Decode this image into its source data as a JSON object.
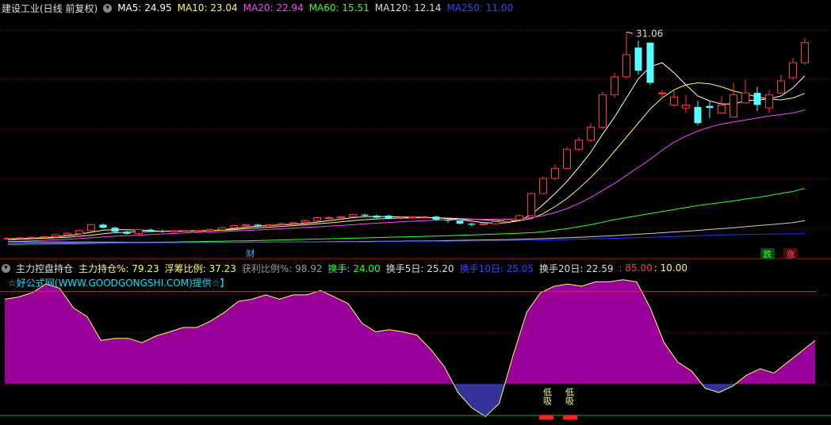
{
  "colors": {
    "up": "#ff3b3b",
    "down": "#55ffff",
    "ma5": "#ffffff",
    "ma10": "#ffff4d",
    "ma20": "#ff44ff",
    "ma60": "#33ff33",
    "ma120": "#cccccc",
    "ma250": "#2233ff",
    "fill_pos": "#990099",
    "fill_neg": "#333399",
    "grid": "#aa0000"
  },
  "header": {
    "stock_title": "建设工业(日线 前复权)",
    "toggle_icon": "chevron-down-icon",
    "ma5_label": "MA5: 24.95",
    "ma10_label": "MA10: 23.04",
    "ma20_label": "MA20: 22.94",
    "ma60_label": "MA60: 15.51",
    "ma120_label": "MA120: 12.14",
    "ma250_label": "MA250: 11.00"
  },
  "indicator": {
    "name": "主力控盘持仓",
    "zlcc": "主力持仓%: 79.23",
    "fcbl": "浮筹比例: 37.23",
    "hlbl": "获利比例%: 98.92",
    "hs": "换手: 24.00",
    "hs5": "换手5日: 25.20",
    "hs10": "换手10日: 25.05",
    "hs20": "换手20日: 22.59",
    "level_high": ": 85.00",
    "level_low": ": 10.00",
    "credit": "☆好公式网(WWW.GOODGONGSHI.COM)提供☆】",
    "low_marker": "低吸"
  },
  "markers": {
    "cai": "财",
    "die": "跌",
    "zhang": "涨",
    "high_price": "31.06"
  },
  "chart_data": [
    {
      "type": "candlestick",
      "title": "建设工业(日线 前复权)",
      "high_label": "31.06",
      "ylim": [
        9.8,
        32.5
      ],
      "x": [
        0,
        1,
        2,
        3,
        4,
        5,
        6,
        7,
        8,
        9,
        10,
        11,
        12,
        13,
        14,
        15,
        16,
        17,
        18,
        19,
        20,
        21,
        22,
        23,
        24,
        25,
        26,
        27,
        28,
        29,
        30,
        31,
        32,
        33,
        34,
        35,
        36,
        37,
        38,
        39,
        40,
        41,
        42,
        43,
        44,
        45,
        46,
        47,
        48,
        49,
        50,
        51,
        52,
        53,
        54,
        55,
        56,
        57,
        58,
        59,
        60,
        61,
        62,
        63,
        64,
        65,
        66,
        67
      ],
      "open": [
        10.5,
        10.55,
        10.6,
        10.65,
        10.7,
        10.9,
        11.0,
        11.3,
        11.9,
        11.6,
        11.2,
        11.0,
        11.4,
        11.3,
        11.2,
        11.25,
        11.3,
        11.3,
        11.4,
        11.6,
        11.8,
        11.9,
        11.8,
        11.9,
        12.0,
        12.1,
        12.3,
        12.6,
        12.6,
        12.7,
        12.9,
        12.8,
        12.8,
        12.55,
        12.6,
        12.7,
        12.7,
        12.4,
        12.3,
        12.0,
        11.9,
        12.0,
        12.2,
        12.4,
        12.8,
        15.0,
        16.5,
        17.5,
        19.4,
        20.3,
        21.6,
        24.8,
        26.6,
        29.5,
        30.0,
        25.0,
        23.8,
        23.5,
        23.6,
        23.7,
        23.0,
        22.6,
        24.0,
        25.0,
        23.5,
        25.0,
        26.5,
        28.0
      ],
      "close": [
        10.55,
        10.6,
        10.65,
        10.7,
        10.9,
        11.05,
        11.3,
        11.9,
        11.6,
        11.2,
        11.0,
        11.4,
        11.3,
        11.2,
        11.3,
        11.3,
        11.3,
        11.4,
        11.6,
        11.8,
        11.9,
        11.8,
        11.9,
        12.0,
        12.1,
        12.3,
        12.6,
        12.6,
        12.7,
        12.9,
        12.8,
        12.6,
        12.55,
        12.6,
        12.7,
        12.7,
        12.4,
        12.3,
        12.0,
        11.9,
        12.0,
        12.2,
        12.4,
        12.8,
        15.0,
        16.5,
        17.5,
        19.4,
        20.3,
        21.6,
        24.8,
        26.6,
        28.8,
        27.2,
        26.0,
        25.0,
        24.6,
        23.8,
        22.0,
        23.5,
        23.8,
        24.8,
        25.0,
        23.8,
        24.8,
        26.2,
        28.0,
        30.0
      ],
      "high": [
        10.6,
        10.7,
        10.7,
        10.8,
        11.0,
        11.2,
        11.4,
        12.0,
        12.0,
        11.7,
        11.3,
        11.5,
        11.5,
        11.4,
        11.4,
        11.4,
        11.4,
        11.5,
        11.7,
        11.9,
        12.0,
        12.0,
        12.0,
        12.1,
        12.2,
        12.4,
        12.7,
        12.8,
        12.8,
        13.0,
        13.0,
        12.9,
        12.9,
        12.7,
        12.8,
        12.8,
        12.8,
        12.5,
        12.4,
        12.1,
        12.1,
        12.3,
        12.5,
        12.9,
        15.1,
        16.7,
        17.9,
        19.6,
        20.6,
        22.0,
        25.1,
        27.0,
        31.06,
        30.2,
        28.0,
        25.3,
        25.2,
        24.8,
        24.2,
        24.2,
        24.7,
        26.0,
        26.3,
        25.6,
        25.3,
        26.8,
        28.5,
        30.5
      ],
      "low": [
        10.4,
        10.5,
        10.5,
        10.6,
        10.6,
        10.8,
        10.9,
        11.2,
        11.5,
        11.1,
        10.9,
        10.9,
        11.2,
        11.1,
        11.1,
        11.1,
        11.2,
        11.2,
        11.3,
        11.5,
        11.7,
        11.7,
        11.7,
        11.8,
        11.9,
        12.0,
        12.2,
        12.4,
        12.4,
        12.6,
        12.7,
        12.5,
        12.4,
        12.4,
        12.5,
        12.5,
        12.3,
        12.1,
        11.9,
        11.7,
        11.8,
        11.9,
        12.1,
        12.3,
        12.7,
        14.9,
        16.3,
        17.4,
        19.2,
        20.1,
        21.4,
        24.5,
        26.4,
        26.8,
        25.8,
        24.5,
        23.6,
        23.0,
        21.8,
        22.5,
        23.0,
        24.2,
        24.6,
        23.2,
        23.0,
        24.9,
        26.3,
        27.8
      ],
      "ma_series": [
        {
          "name": "MA5",
          "values": [
            10.5,
            10.5,
            10.55,
            10.6,
            10.7,
            10.8,
            10.95,
            11.15,
            11.35,
            11.4,
            11.4,
            11.35,
            11.3,
            11.25,
            11.25,
            11.25,
            11.28,
            11.3,
            11.4,
            11.5,
            11.65,
            11.75,
            11.82,
            11.88,
            11.94,
            12.02,
            12.16,
            12.3,
            12.45,
            12.6,
            12.7,
            12.72,
            12.7,
            12.65,
            12.65,
            12.62,
            12.58,
            12.5,
            12.4,
            12.25,
            12.1,
            12.05,
            12.1,
            12.3,
            12.9,
            13.9,
            15.0,
            16.2,
            17.6,
            19.1,
            20.9,
            22.6,
            24.5,
            26.4,
            27.6,
            28.0,
            27.0,
            25.8,
            24.7,
            24.2,
            23.9,
            23.9,
            24.2,
            24.3,
            24.4,
            24.7,
            25.5,
            26.7
          ]
        },
        {
          "name": "MA10",
          "values": [
            10.4,
            10.45,
            10.5,
            10.55,
            10.6,
            10.65,
            10.75,
            10.85,
            11.0,
            11.1,
            11.15,
            11.2,
            11.22,
            11.25,
            11.27,
            11.28,
            11.3,
            11.32,
            11.35,
            11.4,
            11.5,
            11.58,
            11.65,
            11.72,
            11.8,
            11.88,
            11.98,
            12.08,
            12.18,
            12.3,
            12.4,
            12.47,
            12.52,
            12.55,
            12.58,
            12.6,
            12.58,
            12.55,
            12.5,
            12.45,
            12.38,
            12.3,
            12.25,
            12.3,
            12.5,
            13.0,
            13.7,
            14.5,
            15.5,
            16.6,
            17.8,
            19.2,
            20.6,
            22.0,
            23.4,
            24.5,
            25.3,
            25.8,
            26.0,
            25.9,
            25.6,
            25.2,
            24.9,
            24.6,
            24.4,
            24.3,
            24.5,
            24.95
          ]
        },
        {
          "name": "MA20",
          "values": [
            10.2,
            10.25,
            10.3,
            10.35,
            10.4,
            10.45,
            10.52,
            10.6,
            10.68,
            10.75,
            10.8,
            10.86,
            10.92,
            10.98,
            11.03,
            11.08,
            11.13,
            11.18,
            11.22,
            11.27,
            11.32,
            11.38,
            11.44,
            11.5,
            11.56,
            11.62,
            11.68,
            11.75,
            11.82,
            11.9,
            11.98,
            12.05,
            12.12,
            12.18,
            12.24,
            12.3,
            12.34,
            12.37,
            12.4,
            12.42,
            12.43,
            12.44,
            12.45,
            12.5,
            12.6,
            12.8,
            13.1,
            13.5,
            14.0,
            14.6,
            15.3,
            16.0,
            16.8,
            17.6,
            18.4,
            19.3,
            20.1,
            20.7,
            21.2,
            21.6,
            21.9,
            22.1,
            22.3,
            22.5,
            22.7,
            22.85,
            23.0,
            23.3
          ]
        },
        {
          "name": "MA60",
          "values": [
            9.95,
            9.96,
            9.97,
            9.98,
            9.99,
            10.0,
            10.02,
            10.04,
            10.06,
            10.08,
            10.1,
            10.12,
            10.14,
            10.16,
            10.18,
            10.2,
            10.22,
            10.24,
            10.26,
            10.28,
            10.3,
            10.32,
            10.35,
            10.38,
            10.41,
            10.44,
            10.47,
            10.5,
            10.53,
            10.56,
            10.59,
            10.62,
            10.65,
            10.68,
            10.71,
            10.74,
            10.77,
            10.8,
            10.84,
            10.88,
            10.92,
            10.96,
            11.0,
            11.05,
            11.1,
            11.2,
            11.35,
            11.5,
            11.7,
            11.9,
            12.15,
            12.4,
            12.6,
            12.8,
            13.0,
            13.2,
            13.4,
            13.6,
            13.8,
            13.95,
            14.1,
            14.25,
            14.45,
            14.6,
            14.8,
            15.0,
            15.2,
            15.5
          ]
        },
        {
          "name": "MA120",
          "values": [
            10.2,
            10.2,
            10.19,
            10.19,
            10.18,
            10.18,
            10.17,
            10.17,
            10.16,
            10.16,
            10.15,
            10.15,
            10.15,
            10.15,
            10.15,
            10.15,
            10.15,
            10.15,
            10.15,
            10.15,
            10.16,
            10.16,
            10.17,
            10.17,
            10.18,
            10.18,
            10.19,
            10.2,
            10.21,
            10.22,
            10.23,
            10.24,
            10.25,
            10.26,
            10.27,
            10.28,
            10.3,
            10.32,
            10.34,
            10.36,
            10.38,
            10.4,
            10.42,
            10.45,
            10.48,
            10.52,
            10.56,
            10.6,
            10.65,
            10.7,
            10.75,
            10.82,
            10.88,
            10.95,
            11.02,
            11.1,
            11.18,
            11.25,
            11.33,
            11.42,
            11.5,
            11.6,
            11.7,
            11.8,
            11.9,
            12.0,
            12.1,
            12.3
          ]
        },
        {
          "name": "MA250",
          "values": [
            10.05,
            10.05,
            10.06,
            10.06,
            10.07,
            10.07,
            10.08,
            10.08,
            10.09,
            10.09,
            10.1,
            10.1,
            10.1,
            10.11,
            10.11,
            10.12,
            10.12,
            10.13,
            10.13,
            10.14,
            10.14,
            10.15,
            10.15,
            10.16,
            10.16,
            10.17,
            10.17,
            10.18,
            10.18,
            10.19,
            10.19,
            10.2,
            10.21,
            10.22,
            10.23,
            10.24,
            10.25,
            10.26,
            10.27,
            10.28,
            10.29,
            10.3,
            10.32,
            10.34,
            10.36,
            10.38,
            10.4,
            10.43,
            10.46,
            10.49,
            10.52,
            10.55,
            10.58,
            10.61,
            10.64,
            10.68,
            10.72,
            10.76,
            10.8,
            10.84,
            10.87,
            10.9,
            10.93,
            10.95,
            10.97,
            10.98,
            11.0,
            11.0
          ]
        }
      ]
    },
    {
      "type": "area",
      "title": "主力控盘持仓",
      "ylim": [
        -32,
        98
      ],
      "reference_lines": [
        85,
        10
      ],
      "x": [
        0,
        1,
        2,
        3,
        4,
        5,
        6,
        7,
        8,
        9,
        10,
        11,
        12,
        13,
        14,
        15,
        16,
        17,
        18,
        19,
        20,
        21,
        22,
        23,
        24,
        25,
        26,
        27,
        28,
        29,
        30,
        31,
        32,
        33,
        34,
        35,
        36,
        37,
        38,
        39,
        40,
        41,
        42,
        43,
        44,
        45,
        46,
        47,
        48,
        49,
        50,
        51,
        52,
        53,
        54,
        55,
        56,
        57,
        58,
        59,
        60,
        61,
        62,
        63,
        64,
        65,
        66,
        67
      ],
      "values": [
        78,
        80,
        84,
        92,
        88,
        70,
        62,
        40,
        42,
        42,
        38,
        44,
        48,
        52,
        52,
        58,
        66,
        76,
        78,
        82,
        78,
        82,
        82,
        86,
        80,
        74,
        56,
        48,
        50,
        48,
        45,
        32,
        16,
        -8,
        -22,
        -30,
        -18,
        26,
        66,
        84,
        90,
        92,
        90,
        94,
        94,
        96,
        94,
        70,
        38,
        20,
        12,
        -4,
        -8,
        -2,
        8,
        14,
        10,
        20,
        30,
        40
      ]
    }
  ]
}
